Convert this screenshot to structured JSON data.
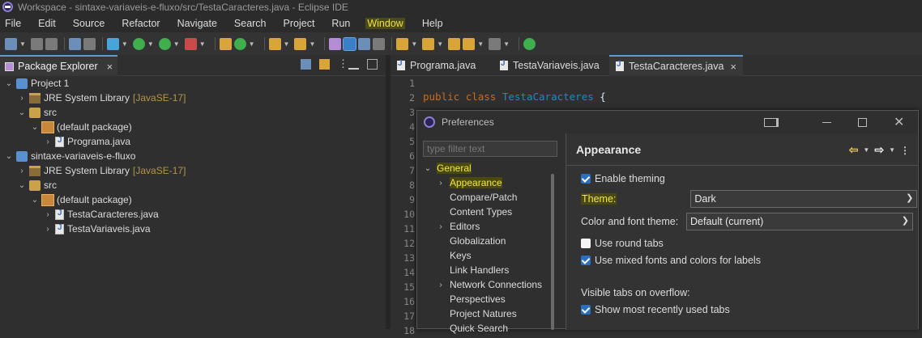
{
  "window": {
    "title": "Workspace - sintaxe-variaveis-e-fluxo/src/TestaCaracteres.java - Eclipse IDE"
  },
  "menu": [
    "File",
    "Edit",
    "Source",
    "Refactor",
    "Navigate",
    "Search",
    "Project",
    "Run",
    "Window",
    "Help"
  ],
  "explorer": {
    "tab_label": "Package Explorer",
    "tree": [
      {
        "depth": 0,
        "twisty": "v",
        "icon": "project-icon",
        "label": "Project 1"
      },
      {
        "depth": 1,
        "twisty": ">",
        "icon": "library-icon",
        "label": "JRE System Library",
        "tag": "[JavaSE-17]"
      },
      {
        "depth": 1,
        "twisty": "v",
        "icon": "source-folder-icon",
        "label": "src"
      },
      {
        "depth": 2,
        "twisty": "v",
        "icon": "package-icon",
        "label": "(default package)"
      },
      {
        "depth": 3,
        "twisty": ">",
        "icon": "java-file-icon",
        "label": "Programa.java"
      },
      {
        "depth": 0,
        "twisty": "v",
        "icon": "project-icon",
        "label": "sintaxe-variaveis-e-fluxo"
      },
      {
        "depth": 1,
        "twisty": ">",
        "icon": "library-icon",
        "label": "JRE System Library",
        "tag": "[JavaSE-17]"
      },
      {
        "depth": 1,
        "twisty": "v",
        "icon": "source-folder-icon",
        "label": "src"
      },
      {
        "depth": 2,
        "twisty": "v",
        "icon": "package-icon",
        "label": "(default package)"
      },
      {
        "depth": 3,
        "twisty": ">",
        "icon": "java-file-icon",
        "label": "TestaCaracteres.java"
      },
      {
        "depth": 3,
        "twisty": ">",
        "icon": "java-file-icon",
        "label": "TestaVariaveis.java"
      }
    ]
  },
  "editor": {
    "tabs": [
      "Programa.java",
      "TestaVariaveis.java",
      "TestaCaracteres.java"
    ],
    "line_numbers": [
      "1",
      "2",
      "3",
      "4",
      "5",
      "6",
      "7",
      "8",
      "9",
      "10",
      "11",
      "12",
      "13",
      "14",
      "15",
      "16",
      "17",
      "18"
    ],
    "code": {
      "kw1": "public",
      "kw2": "class",
      "name": "TestaCaracteres",
      "brace": "{"
    }
  },
  "preferences": {
    "title": "Preferences",
    "filter_placeholder": "type filter text",
    "tree": [
      {
        "depth": 0,
        "twisty": "v",
        "label": "General",
        "highlight": true
      },
      {
        "depth": 1,
        "twisty": ">",
        "label": "Appearance",
        "highlight": true
      },
      {
        "depth": 1,
        "twisty": "",
        "label": "Compare/Patch"
      },
      {
        "depth": 1,
        "twisty": "",
        "label": "Content Types"
      },
      {
        "depth": 1,
        "twisty": ">",
        "label": "Editors"
      },
      {
        "depth": 1,
        "twisty": "",
        "label": "Globalization"
      },
      {
        "depth": 1,
        "twisty": "",
        "label": "Keys"
      },
      {
        "depth": 1,
        "twisty": "",
        "label": "Link Handlers"
      },
      {
        "depth": 1,
        "twisty": ">",
        "label": "Network Connections"
      },
      {
        "depth": 1,
        "twisty": "",
        "label": "Perspectives"
      },
      {
        "depth": 1,
        "twisty": "",
        "label": "Project Natures"
      },
      {
        "depth": 1,
        "twisty": "",
        "label": "Quick Search"
      }
    ],
    "page_title": "Appearance",
    "enable_theming": {
      "label": "Enable theming",
      "checked": true
    },
    "theme": {
      "label": "Theme:",
      "value": "Dark"
    },
    "color_font_theme": {
      "label": "Color and font theme:",
      "value": "Default (current)"
    },
    "round_tabs": {
      "label": "Use round tabs",
      "checked": false
    },
    "mixed_fonts": {
      "label": "Use mixed fonts and colors for labels",
      "checked": true
    },
    "overflow_label": "Visible tabs on overflow:",
    "recent_tabs": {
      "label": "Show most recently used tabs",
      "checked": true
    }
  }
}
